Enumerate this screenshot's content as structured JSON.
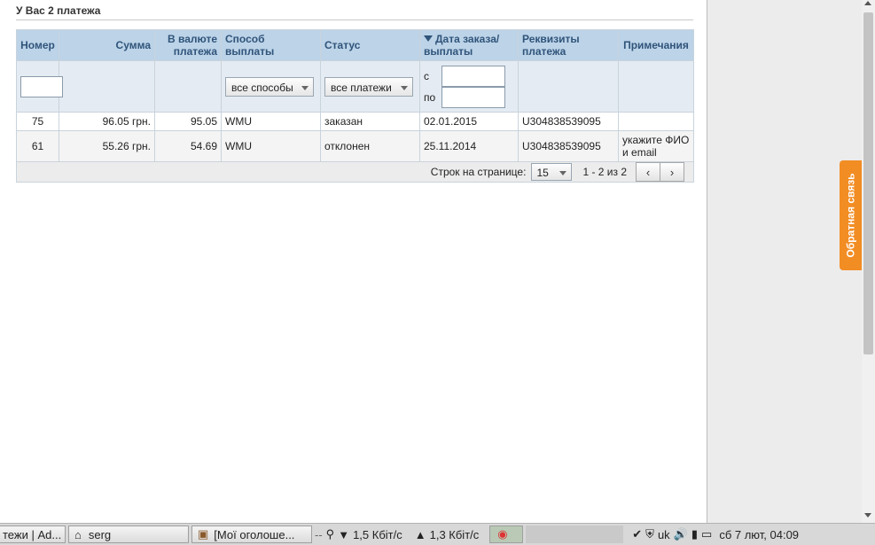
{
  "page": {
    "title": "У Вас 2 платежа"
  },
  "table": {
    "columns": [
      "Номер",
      "Сумма",
      "В валюте платежа",
      "Способ выплаты",
      "Статус",
      "Дата заказа/ выплаты",
      "Реквизиты платежа",
      "Примечания"
    ],
    "filters": {
      "method_select": "все способы",
      "status_select": "все платежи",
      "date_from_label": "с",
      "date_to_label": "по"
    },
    "rows": [
      {
        "number": "75",
        "sum": "96.05 грн.",
        "currency_value": "95.05",
        "method": "WMU",
        "status": "заказан",
        "date": "02.01.2015",
        "requisites": "U304838539095",
        "note": ""
      },
      {
        "number": "61",
        "sum": "55.26 грн.",
        "currency_value": "54.69",
        "method": "WMU",
        "status": "отклонен",
        "date": "25.11.2014",
        "requisites": "U304838539095",
        "note": "укажите ФИО и email"
      }
    ],
    "pager": {
      "rows_label": "Строк на странице:",
      "rows_value": "15",
      "range": "1 - 2 из 2",
      "prev": "‹",
      "next": "›"
    }
  },
  "feedback": {
    "label": "Обратная связь",
    "color": "#f28d24"
  },
  "taskbar": {
    "tasks": [
      "тежи | Ad...",
      "serg",
      "[Мої оголоше..."
    ],
    "net_down": "1,5 Кбіт/с",
    "net_up": "1,3 Кбіт/с",
    "lang": "uk",
    "clock": "сб  7 лют, 04:09"
  },
  "colors": {
    "header_bg": "#bcd3e8",
    "header_text": "#30547a",
    "filter_bg": "#e4ebf2"
  }
}
